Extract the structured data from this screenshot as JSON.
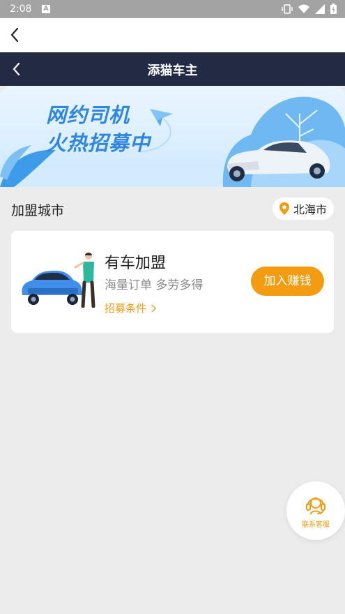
{
  "status_bar": {
    "time": "2:08",
    "notification_icon": "A"
  },
  "header": {
    "title": "添猫车主"
  },
  "banner": {
    "headline_line1": "网约司机",
    "headline_line2": "火热招募中"
  },
  "city": {
    "label": "加盟城市",
    "selected": "北海市"
  },
  "card": {
    "title": "有车加盟",
    "subtitle": "海量订单 多劳多得",
    "link_label": "招募条件",
    "button_label": "加入赚钱"
  },
  "support": {
    "label": "联系客服"
  },
  "colors": {
    "accent": "#f39c12",
    "header_bg": "#232a44",
    "headline_blue": "#2e86e0"
  }
}
